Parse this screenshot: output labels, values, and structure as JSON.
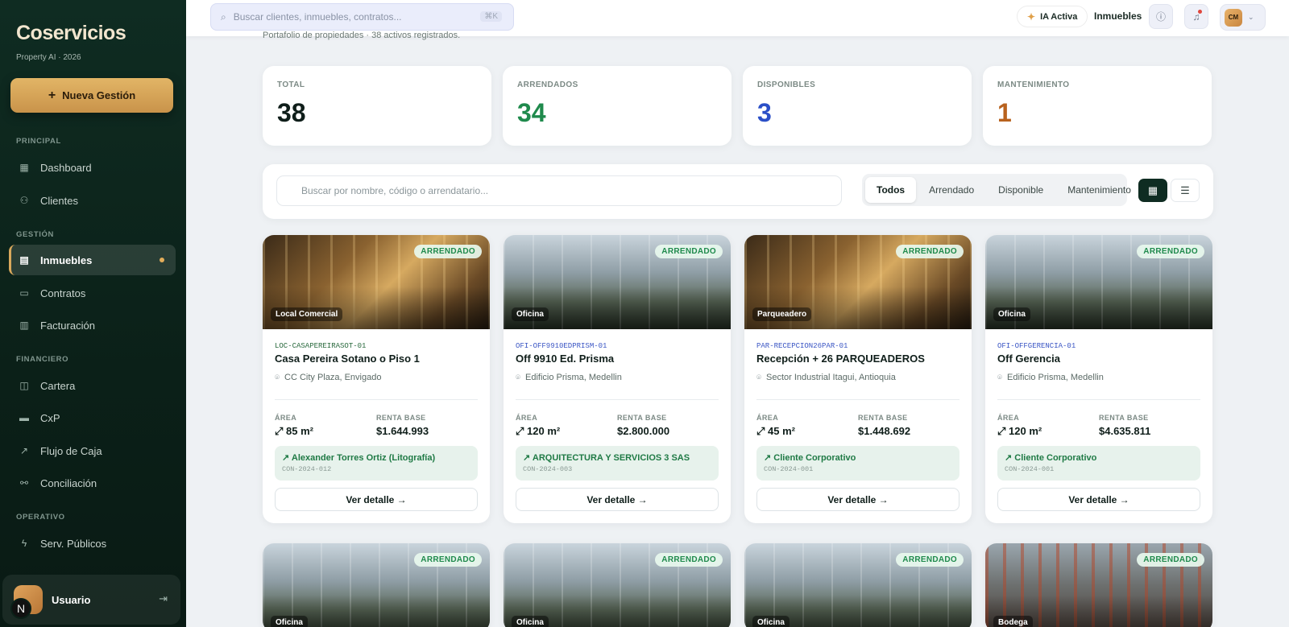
{
  "sidebar": {
    "brand": "Coservicios",
    "subtitle": "Property AI · 2026",
    "new_button": "Nueva Gestión",
    "sections": {
      "principal": "PRINCIPAL",
      "gestion": "GESTIÓN",
      "financiero": "FINANCIERO",
      "operativo": "OPERATIVO"
    },
    "items": {
      "dashboard": "Dashboard",
      "clientes": "Clientes",
      "inmuebles": "Inmuebles",
      "contratos": "Contratos",
      "facturacion": "Facturación",
      "cartera": "Cartera",
      "cxp": "CxP",
      "flujo": "Flujo de Caja",
      "conciliacion": "Conciliación",
      "servicios": "Serv. Públicos"
    },
    "user": {
      "name": "Usuario",
      "initial": "N"
    }
  },
  "header": {
    "search_placeholder": "Buscar clientes, inmuebles, contratos...",
    "shortcut": "⌘K",
    "ia_label": "IA Activa",
    "current_section": "Inmuebles",
    "user_initials": "CM"
  },
  "breadcrumb": "Portafolio de propiedades · 38 activos registrados.",
  "stats": [
    {
      "label": "TOTAL",
      "value": "38",
      "color": "#0f1e1a"
    },
    {
      "label": "ARRENDADOS",
      "value": "34",
      "color": "#1f8a4c"
    },
    {
      "label": "DISPONIBLES",
      "value": "3",
      "color": "#2b4fc7"
    },
    {
      "label": "MANTENIMIENTO",
      "value": "1",
      "color": "#b8621e"
    }
  ],
  "filters": {
    "search_placeholder": "Buscar por nombre, código o arrendatario...",
    "tabs": [
      "Todos",
      "Arrendado",
      "Disponible",
      "Mantenimiento"
    ]
  },
  "labels": {
    "area": "ÁREA",
    "renta": "RENTA BASE",
    "detail": "Ver detalle →"
  },
  "properties": [
    {
      "status": "ARRENDADO",
      "type": "Local Comercial",
      "code": "LOC-CASAPEREIRASOT-01",
      "name": "Casa Pereira Sotano o Piso 1",
      "location": "CC City Plaza, Envigado",
      "area": "85 m²",
      "rent": "$1.644.993",
      "tenant": "Alexander Torres Ortiz (Litografía)",
      "contract": "CON-2024-012"
    },
    {
      "status": "ARRENDADO",
      "type": "Oficina",
      "code": "OFI-OFF9910EDPRISM-01",
      "name": "Off 9910 Ed. Prisma",
      "location": "Edificio Prisma, Medellin",
      "area": "120 m²",
      "rent": "$2.800.000",
      "tenant": "ARQUITECTURA Y SERVICIOS 3 SAS",
      "contract": "CON-2024-003"
    },
    {
      "status": "ARRENDADO",
      "type": "Parqueadero",
      "code": "PAR-RECEPCION26PAR-01",
      "name": "Recepción + 26 PARQUEADEROS",
      "location": "Sector Industrial Itagui, Antioquia",
      "area": "45 m²",
      "rent": "$1.448.692",
      "tenant": "Cliente Corporativo",
      "contract": "CON-2024-001"
    },
    {
      "status": "ARRENDADO",
      "type": "Oficina",
      "code": "OFI-OFFGERENCIA-01",
      "name": "Off Gerencia",
      "location": "Edificio Prisma, Medellin",
      "area": "120 m²",
      "rent": "$4.635.811",
      "tenant": "Cliente Corporativo",
      "contract": "CON-2024-001"
    },
    {
      "status": "ARRENDADO",
      "type": "Oficina"
    },
    {
      "status": "ARRENDADO",
      "type": "Oficina"
    },
    {
      "status": "ARRENDADO",
      "type": "Oficina"
    },
    {
      "status": "ARRENDADO",
      "type": "Bodega"
    }
  ]
}
